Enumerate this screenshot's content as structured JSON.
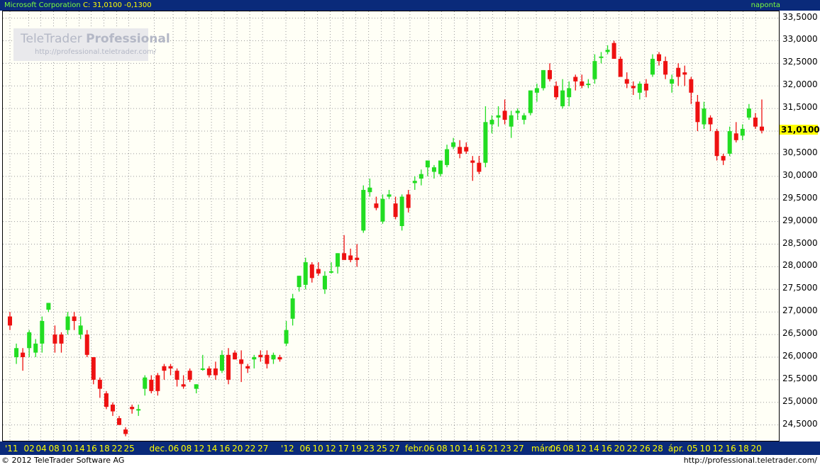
{
  "header": {
    "name": "Microsoft Corporation",
    "close_label": "C: 31,0100 -0,1300",
    "interval": "naponta"
  },
  "logo": {
    "main_light": "TeleTrader ",
    "main_bold": "Professional",
    "sub": "http://professional.teletrader.com/"
  },
  "footer": {
    "left": "© 2012 TeleTrader Software AG",
    "right": "http://professional.teletrader.com/"
  },
  "colors": {
    "up": "#22dd22",
    "down": "#ee1111",
    "header_bg": "#0a2a7a",
    "header_text": "#ffff00",
    "grid": "#9a9a9a"
  },
  "chart_data": {
    "type": "candlestick",
    "title": "Microsoft Corporation",
    "last_value_label": "31,0100",
    "y_ticks": [
      "33,5000",
      "33,0000",
      "32,5000",
      "32,0000",
      "31,5000",
      "31,0000",
      "30,5000",
      "30,0000",
      "29,5000",
      "29,0000",
      "28,5000",
      "28,0000",
      "27,5000",
      "27,0000",
      "26,5000",
      "26,0000",
      "25,5000",
      "25,0000",
      "24,5000"
    ],
    "ylim": [
      24.15,
      33.65
    ],
    "last_value": 31.01,
    "x_ticks": [
      "'11",
      "02",
      "04",
      "08",
      "10",
      "14",
      "16",
      "18",
      "22",
      "25",
      "dec.",
      "06",
      "08",
      "12",
      "14",
      "16",
      "20",
      "22",
      "27",
      "'12",
      "06",
      "10",
      "12",
      "17",
      "19",
      "23",
      "25",
      "27",
      "febr.",
      "06",
      "08",
      "10",
      "14",
      "16",
      "21",
      "23",
      "27",
      "márc.",
      "06",
      "08",
      "12",
      "14",
      "16",
      "20",
      "22",
      "26",
      "28",
      "ápr.",
      "05",
      "10",
      "12",
      "16",
      "18",
      "20"
    ],
    "x_tick_positions": [
      0.0,
      0.025,
      0.041,
      0.058,
      0.075,
      0.092,
      0.108,
      0.125,
      0.142,
      0.158,
      0.192,
      0.217,
      0.234,
      0.251,
      0.268,
      0.285,
      0.302,
      0.319,
      0.336,
      0.367,
      0.392,
      0.409,
      0.426,
      0.443,
      0.46,
      0.477,
      0.494,
      0.511,
      0.532,
      0.557,
      0.574,
      0.591,
      0.608,
      0.625,
      0.642,
      0.659,
      0.676,
      0.7,
      0.725,
      0.742,
      0.759,
      0.776,
      0.793,
      0.81,
      0.827,
      0.844,
      0.861,
      0.882,
      0.907,
      0.924,
      0.941,
      0.958,
      0.975,
      0.992
    ],
    "candles": [
      {
        "o": 26.9,
        "h": 27.0,
        "l": 26.6,
        "c": 26.7
      },
      {
        "o": 26.0,
        "h": 26.3,
        "l": 25.85,
        "c": 26.2
      },
      {
        "o": 26.1,
        "h": 26.2,
        "l": 25.7,
        "c": 26.0
      },
      {
        "o": 26.2,
        "h": 26.6,
        "l": 26.0,
        "c": 26.55
      },
      {
        "o": 26.1,
        "h": 26.4,
        "l": 26.0,
        "c": 26.3
      },
      {
        "o": 26.3,
        "h": 26.9,
        "l": 26.1,
        "c": 26.8
      },
      {
        "o": 27.05,
        "h": 27.2,
        "l": 27.0,
        "c": 27.2
      },
      {
        "o": 26.5,
        "h": 26.7,
        "l": 26.1,
        "c": 26.3
      },
      {
        "o": 26.5,
        "h": 26.55,
        "l": 26.1,
        "c": 26.3
      },
      {
        "o": 26.6,
        "h": 27.0,
        "l": 26.5,
        "c": 26.9
      },
      {
        "o": 26.9,
        "h": 27.0,
        "l": 26.6,
        "c": 26.8
      },
      {
        "o": 26.5,
        "h": 26.9,
        "l": 26.4,
        "c": 26.7
      },
      {
        "o": 26.5,
        "h": 26.6,
        "l": 26.0,
        "c": 26.05
      },
      {
        "o": 26.0,
        "h": 26.0,
        "l": 25.4,
        "c": 25.5
      },
      {
        "o": 25.5,
        "h": 25.55,
        "l": 25.1,
        "c": 25.3
      },
      {
        "o": 25.2,
        "h": 25.25,
        "l": 24.85,
        "c": 24.9
      },
      {
        "o": 24.95,
        "h": 25.0,
        "l": 24.7,
        "c": 24.8
      },
      {
        "o": 24.65,
        "h": 24.7,
        "l": 24.5,
        "c": 24.5
      },
      {
        "o": 24.4,
        "h": 24.45,
        "l": 24.25,
        "c": 24.3
      },
      {
        "o": 24.9,
        "h": 24.95,
        "l": 24.75,
        "c": 24.85
      },
      {
        "o": 24.85,
        "h": 24.95,
        "l": 24.7,
        "c": 24.85
      },
      {
        "o": 25.3,
        "h": 25.6,
        "l": 25.15,
        "c": 25.55
      },
      {
        "o": 25.5,
        "h": 25.6,
        "l": 25.2,
        "c": 25.25
      },
      {
        "o": 25.6,
        "h": 25.65,
        "l": 25.15,
        "c": 25.25
      },
      {
        "o": 25.8,
        "h": 25.85,
        "l": 25.5,
        "c": 25.7
      },
      {
        "o": 25.8,
        "h": 25.85,
        "l": 25.6,
        "c": 25.75
      },
      {
        "o": 25.7,
        "h": 25.75,
        "l": 25.35,
        "c": 25.5
      },
      {
        "o": 25.4,
        "h": 25.6,
        "l": 25.3,
        "c": 25.35
      },
      {
        "o": 25.7,
        "h": 25.75,
        "l": 25.45,
        "c": 25.5
      },
      {
        "o": 25.3,
        "h": 25.4,
        "l": 25.2,
        "c": 25.4
      },
      {
        "o": 25.75,
        "h": 26.05,
        "l": 25.7,
        "c": 25.75
      },
      {
        "o": 25.75,
        "h": 25.8,
        "l": 25.55,
        "c": 25.6
      },
      {
        "o": 25.75,
        "h": 25.9,
        "l": 25.5,
        "c": 25.6
      },
      {
        "o": 25.7,
        "h": 26.15,
        "l": 25.65,
        "c": 26.05
      },
      {
        "o": 26.05,
        "h": 26.2,
        "l": 25.4,
        "c": 25.5
      },
      {
        "o": 26.1,
        "h": 26.15,
        "l": 25.95,
        "c": 25.95
      },
      {
        "o": 25.95,
        "h": 26.15,
        "l": 25.45,
        "c": 25.85
      },
      {
        "o": 25.8,
        "h": 25.85,
        "l": 25.65,
        "c": 25.75
      },
      {
        "o": 25.95,
        "h": 26.05,
        "l": 25.75,
        "c": 26.0
      },
      {
        "o": 26.05,
        "h": 26.15,
        "l": 25.9,
        "c": 26.0
      },
      {
        "o": 26.05,
        "h": 26.15,
        "l": 25.75,
        "c": 25.85
      },
      {
        "o": 25.95,
        "h": 26.1,
        "l": 25.85,
        "c": 26.05
      },
      {
        "o": 26.0,
        "h": 26.05,
        "l": 25.9,
        "c": 25.95
      },
      {
        "o": 26.3,
        "h": 26.8,
        "l": 26.25,
        "c": 26.6
      },
      {
        "o": 26.85,
        "h": 27.4,
        "l": 26.7,
        "c": 27.3
      },
      {
        "o": 27.55,
        "h": 27.8,
        "l": 27.45,
        "c": 27.8
      },
      {
        "o": 27.6,
        "h": 28.2,
        "l": 27.5,
        "c": 28.1
      },
      {
        "o": 28.05,
        "h": 28.1,
        "l": 27.65,
        "c": 27.75
      },
      {
        "o": 27.95,
        "h": 28.1,
        "l": 27.8,
        "c": 27.85
      },
      {
        "o": 27.5,
        "h": 27.9,
        "l": 27.4,
        "c": 27.8
      },
      {
        "o": 27.9,
        "h": 28.1,
        "l": 27.85,
        "c": 27.9
      },
      {
        "o": 28.0,
        "h": 28.3,
        "l": 27.85,
        "c": 28.3
      },
      {
        "o": 28.3,
        "h": 28.7,
        "l": 28.2,
        "c": 28.15
      },
      {
        "o": 28.25,
        "h": 28.4,
        "l": 28.1,
        "c": 28.15
      },
      {
        "o": 28.2,
        "h": 28.5,
        "l": 28.0,
        "c": 28.15
      },
      {
        "o": 28.8,
        "h": 29.8,
        "l": 28.75,
        "c": 29.7
      },
      {
        "o": 29.65,
        "h": 29.95,
        "l": 29.55,
        "c": 29.75
      },
      {
        "o": 29.4,
        "h": 29.55,
        "l": 29.25,
        "c": 29.3
      },
      {
        "o": 29.0,
        "h": 29.6,
        "l": 28.95,
        "c": 29.5
      },
      {
        "o": 29.55,
        "h": 29.7,
        "l": 29.5,
        "c": 29.6
      },
      {
        "o": 29.4,
        "h": 29.55,
        "l": 29.05,
        "c": 29.1
      },
      {
        "o": 28.9,
        "h": 29.6,
        "l": 28.8,
        "c": 29.55
      },
      {
        "o": 29.6,
        "h": 29.7,
        "l": 29.2,
        "c": 29.3
      },
      {
        "o": 29.85,
        "h": 30.0,
        "l": 29.7,
        "c": 29.9
      },
      {
        "o": 29.95,
        "h": 30.15,
        "l": 29.8,
        "c": 30.05
      },
      {
        "o": 30.2,
        "h": 30.3,
        "l": 30.0,
        "c": 30.35
      },
      {
        "o": 30.1,
        "h": 30.25,
        "l": 29.95,
        "c": 30.2
      },
      {
        "o": 30.05,
        "h": 30.3,
        "l": 30.0,
        "c": 30.35
      },
      {
        "o": 30.25,
        "h": 30.7,
        "l": 30.2,
        "c": 30.6
      },
      {
        "o": 30.65,
        "h": 30.85,
        "l": 30.6,
        "c": 30.75
      },
      {
        "o": 30.65,
        "h": 30.8,
        "l": 30.4,
        "c": 30.5
      },
      {
        "o": 30.65,
        "h": 30.75,
        "l": 30.5,
        "c": 30.55
      },
      {
        "o": 30.35,
        "h": 30.45,
        "l": 29.9,
        "c": 30.3
      },
      {
        "o": 30.3,
        "h": 30.45,
        "l": 30.05,
        "c": 30.1
      },
      {
        "o": 30.3,
        "h": 31.55,
        "l": 30.2,
        "c": 31.2
      },
      {
        "o": 31.15,
        "h": 31.35,
        "l": 30.95,
        "c": 31.25
      },
      {
        "o": 31.3,
        "h": 31.55,
        "l": 31.1,
        "c": 31.35
      },
      {
        "o": 31.45,
        "h": 31.7,
        "l": 31.15,
        "c": 31.25
      },
      {
        "o": 31.1,
        "h": 31.45,
        "l": 30.85,
        "c": 31.35
      },
      {
        "o": 31.4,
        "h": 31.5,
        "l": 31.25,
        "c": 31.45
      },
      {
        "o": 31.25,
        "h": 31.4,
        "l": 31.15,
        "c": 31.35
      },
      {
        "o": 31.4,
        "h": 31.9,
        "l": 31.35,
        "c": 31.9
      },
      {
        "o": 31.85,
        "h": 32.05,
        "l": 31.65,
        "c": 31.95
      },
      {
        "o": 31.95,
        "h": 32.35,
        "l": 31.9,
        "c": 32.35
      },
      {
        "o": 32.35,
        "h": 32.5,
        "l": 32.1,
        "c": 32.15
      },
      {
        "o": 32.0,
        "h": 32.1,
        "l": 31.7,
        "c": 31.75
      },
      {
        "o": 31.55,
        "h": 32.15,
        "l": 31.5,
        "c": 31.9
      },
      {
        "o": 31.75,
        "h": 32.1,
        "l": 31.55,
        "c": 31.95
      },
      {
        "o": 32.2,
        "h": 32.25,
        "l": 31.9,
        "c": 32.1
      },
      {
        "o": 32.1,
        "h": 32.25,
        "l": 31.95,
        "c": 32.0
      },
      {
        "o": 32.05,
        "h": 32.15,
        "l": 31.95,
        "c": 32.05
      },
      {
        "o": 32.15,
        "h": 32.7,
        "l": 32.05,
        "c": 32.55
      },
      {
        "o": 32.65,
        "h": 32.75,
        "l": 32.5,
        "c": 32.65
      },
      {
        "o": 32.75,
        "h": 32.9,
        "l": 32.7,
        "c": 32.8
      },
      {
        "o": 32.95,
        "h": 33.0,
        "l": 32.6,
        "c": 32.6
      },
      {
        "o": 32.6,
        "h": 32.65,
        "l": 32.2,
        "c": 32.2
      },
      {
        "o": 32.15,
        "h": 32.3,
        "l": 31.95,
        "c": 32.05
      },
      {
        "o": 32.0,
        "h": 32.1,
        "l": 31.8,
        "c": 31.95
      },
      {
        "o": 31.85,
        "h": 32.1,
        "l": 31.7,
        "c": 32.05
      },
      {
        "o": 32.05,
        "h": 32.15,
        "l": 31.75,
        "c": 31.9
      },
      {
        "o": 32.25,
        "h": 32.7,
        "l": 32.2,
        "c": 32.6
      },
      {
        "o": 32.7,
        "h": 32.75,
        "l": 32.45,
        "c": 32.55
      },
      {
        "o": 32.55,
        "h": 32.65,
        "l": 32.15,
        "c": 32.25
      },
      {
        "o": 32.05,
        "h": 32.25,
        "l": 31.85,
        "c": 32.15
      },
      {
        "o": 32.4,
        "h": 32.5,
        "l": 32.0,
        "c": 32.2
      },
      {
        "o": 32.3,
        "h": 32.45,
        "l": 32.0,
        "c": 32.25
      },
      {
        "o": 32.15,
        "h": 32.2,
        "l": 31.6,
        "c": 31.85
      },
      {
        "o": 31.65,
        "h": 31.8,
        "l": 31.0,
        "c": 31.2
      },
      {
        "o": 31.15,
        "h": 31.65,
        "l": 31.05,
        "c": 31.5
      },
      {
        "o": 31.3,
        "h": 31.35,
        "l": 31.0,
        "c": 31.15
      },
      {
        "o": 31.0,
        "h": 31.05,
        "l": 30.35,
        "c": 30.45
      },
      {
        "o": 30.45,
        "h": 30.5,
        "l": 30.25,
        "c": 30.35
      },
      {
        "o": 30.5,
        "h": 31.1,
        "l": 30.45,
        "c": 31.0
      },
      {
        "o": 30.95,
        "h": 31.2,
        "l": 30.75,
        "c": 30.8
      },
      {
        "o": 30.9,
        "h": 31.15,
        "l": 30.8,
        "c": 31.05
      },
      {
        "o": 31.3,
        "h": 31.6,
        "l": 31.25,
        "c": 31.5
      },
      {
        "o": 31.3,
        "h": 31.4,
        "l": 31.05,
        "c": 31.1
      },
      {
        "o": 31.1,
        "h": 31.7,
        "l": 30.95,
        "c": 31.01
      }
    ]
  }
}
